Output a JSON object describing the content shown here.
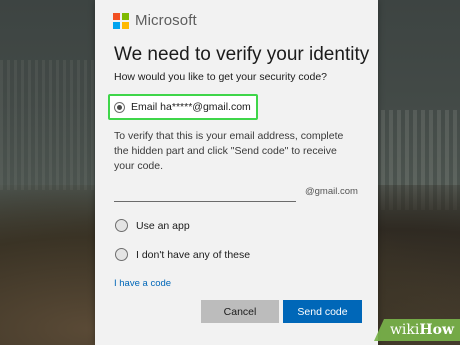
{
  "brand": {
    "name": "Microsoft",
    "logo_colors": [
      "#f25022",
      "#7fba00",
      "#00a4ef",
      "#ffb900"
    ]
  },
  "dialog": {
    "title": "We need to verify your identity",
    "question": "How would you like to get your security code?",
    "options": [
      {
        "label": "Email ha*****@gmail.com",
        "selected": true
      },
      {
        "label": "Use an app",
        "selected": false
      },
      {
        "label": "I don't have any of these",
        "selected": false
      }
    ],
    "instructions": "To verify that this is your email address, complete the hidden part and click \"Send code\" to receive your code.",
    "email_input": {
      "value": "",
      "placeholder": "",
      "suffix": "@gmail.com"
    },
    "have_code_link": "I have a code",
    "buttons": {
      "cancel": "Cancel",
      "send": "Send code"
    }
  },
  "colors": {
    "highlight": "#3fd64a",
    "primary_button": "#0067b8",
    "secondary_button": "#bcbcbc",
    "link": "#0067b8"
  },
  "watermark": {
    "prefix": "wiki",
    "suffix": "How"
  }
}
